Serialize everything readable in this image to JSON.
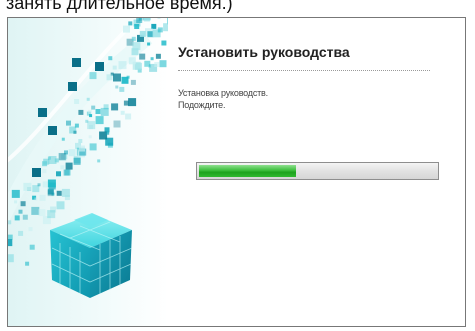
{
  "top_caption": "занять длительное время.)",
  "dialog": {
    "title": "Установить руководства",
    "message_line1": "Установка руководств.",
    "message_line2": "Подождите."
  },
  "progress": {
    "fraction": 0.41
  },
  "colors": {
    "progress_fill": "#2db52d",
    "art_teal": "#14b8c8"
  },
  "icons": {
    "art": "cube-artwork"
  }
}
